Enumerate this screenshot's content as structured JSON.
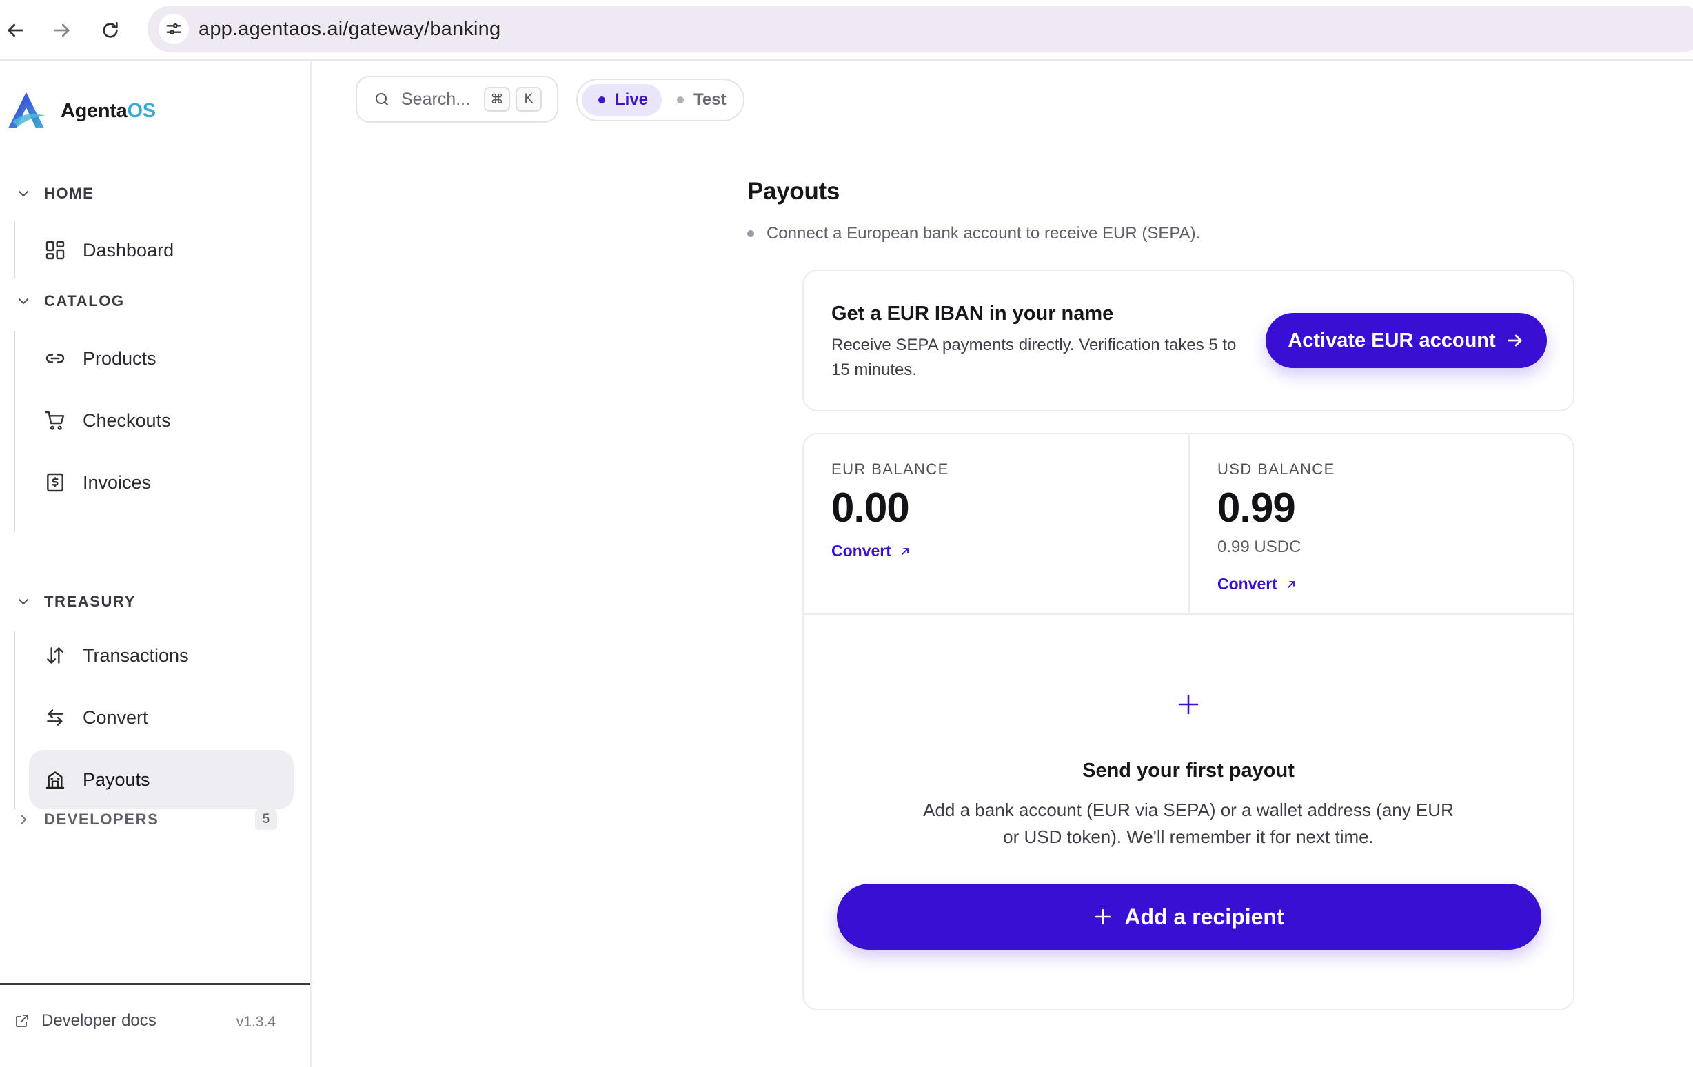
{
  "browser": {
    "url": "app.agentaos.ai/gateway/banking"
  },
  "brand": {
    "name_primary": "Agenta",
    "name_accent": "OS",
    "accent_color": "#3aa9d6",
    "primary_color": "#3a0fd4"
  },
  "sidebar": {
    "sections": [
      {
        "label": "HOME",
        "expanded": true
      },
      {
        "label": "CATALOG",
        "expanded": true
      },
      {
        "label": "TREASURY",
        "expanded": true
      },
      {
        "label": "DEVELOPERS",
        "expanded": false,
        "count": "5"
      }
    ],
    "items": [
      {
        "label": "Dashboard",
        "icon": "dashboard-icon"
      },
      {
        "label": "Products",
        "icon": "link-icon"
      },
      {
        "label": "Checkouts",
        "icon": "cart-icon"
      },
      {
        "label": "Invoices",
        "icon": "invoice-icon"
      },
      {
        "label": "Transactions",
        "icon": "arrows-updown-icon"
      },
      {
        "label": "Convert",
        "icon": "swap-icon"
      },
      {
        "label": "Payouts",
        "icon": "bank-icon",
        "active": true
      }
    ],
    "footer": {
      "docs_label": "Developer docs",
      "version": "v1.3.4"
    }
  },
  "toolbar": {
    "search_placeholder": "Search...",
    "shortcut_keys": [
      "⌘",
      "K"
    ],
    "modes": [
      {
        "label": "Live",
        "selected": true
      },
      {
        "label": "Test",
        "selected": false
      }
    ]
  },
  "page": {
    "title": "Payouts",
    "subtitle": "Connect a European bank account to receive EUR (SEPA)."
  },
  "iban_card": {
    "title": "Get a EUR IBAN in your name",
    "description": "Receive SEPA payments directly. Verification takes 5 to 15 minutes.",
    "button_label": "Activate EUR account"
  },
  "balances": {
    "eur": {
      "label": "EUR BALANCE",
      "amount": "0.00",
      "convert_label": "Convert"
    },
    "usd": {
      "label": "USD BALANCE",
      "amount": "0.99",
      "token_amount": "0.99 USDC",
      "convert_label": "Convert"
    }
  },
  "empty_state": {
    "title": "Send your first payout",
    "description": "Add a bank account (EUR via SEPA) or a wallet address (any EUR or USD token). We'll remember it for next time.",
    "button_label": "Add a recipient"
  }
}
